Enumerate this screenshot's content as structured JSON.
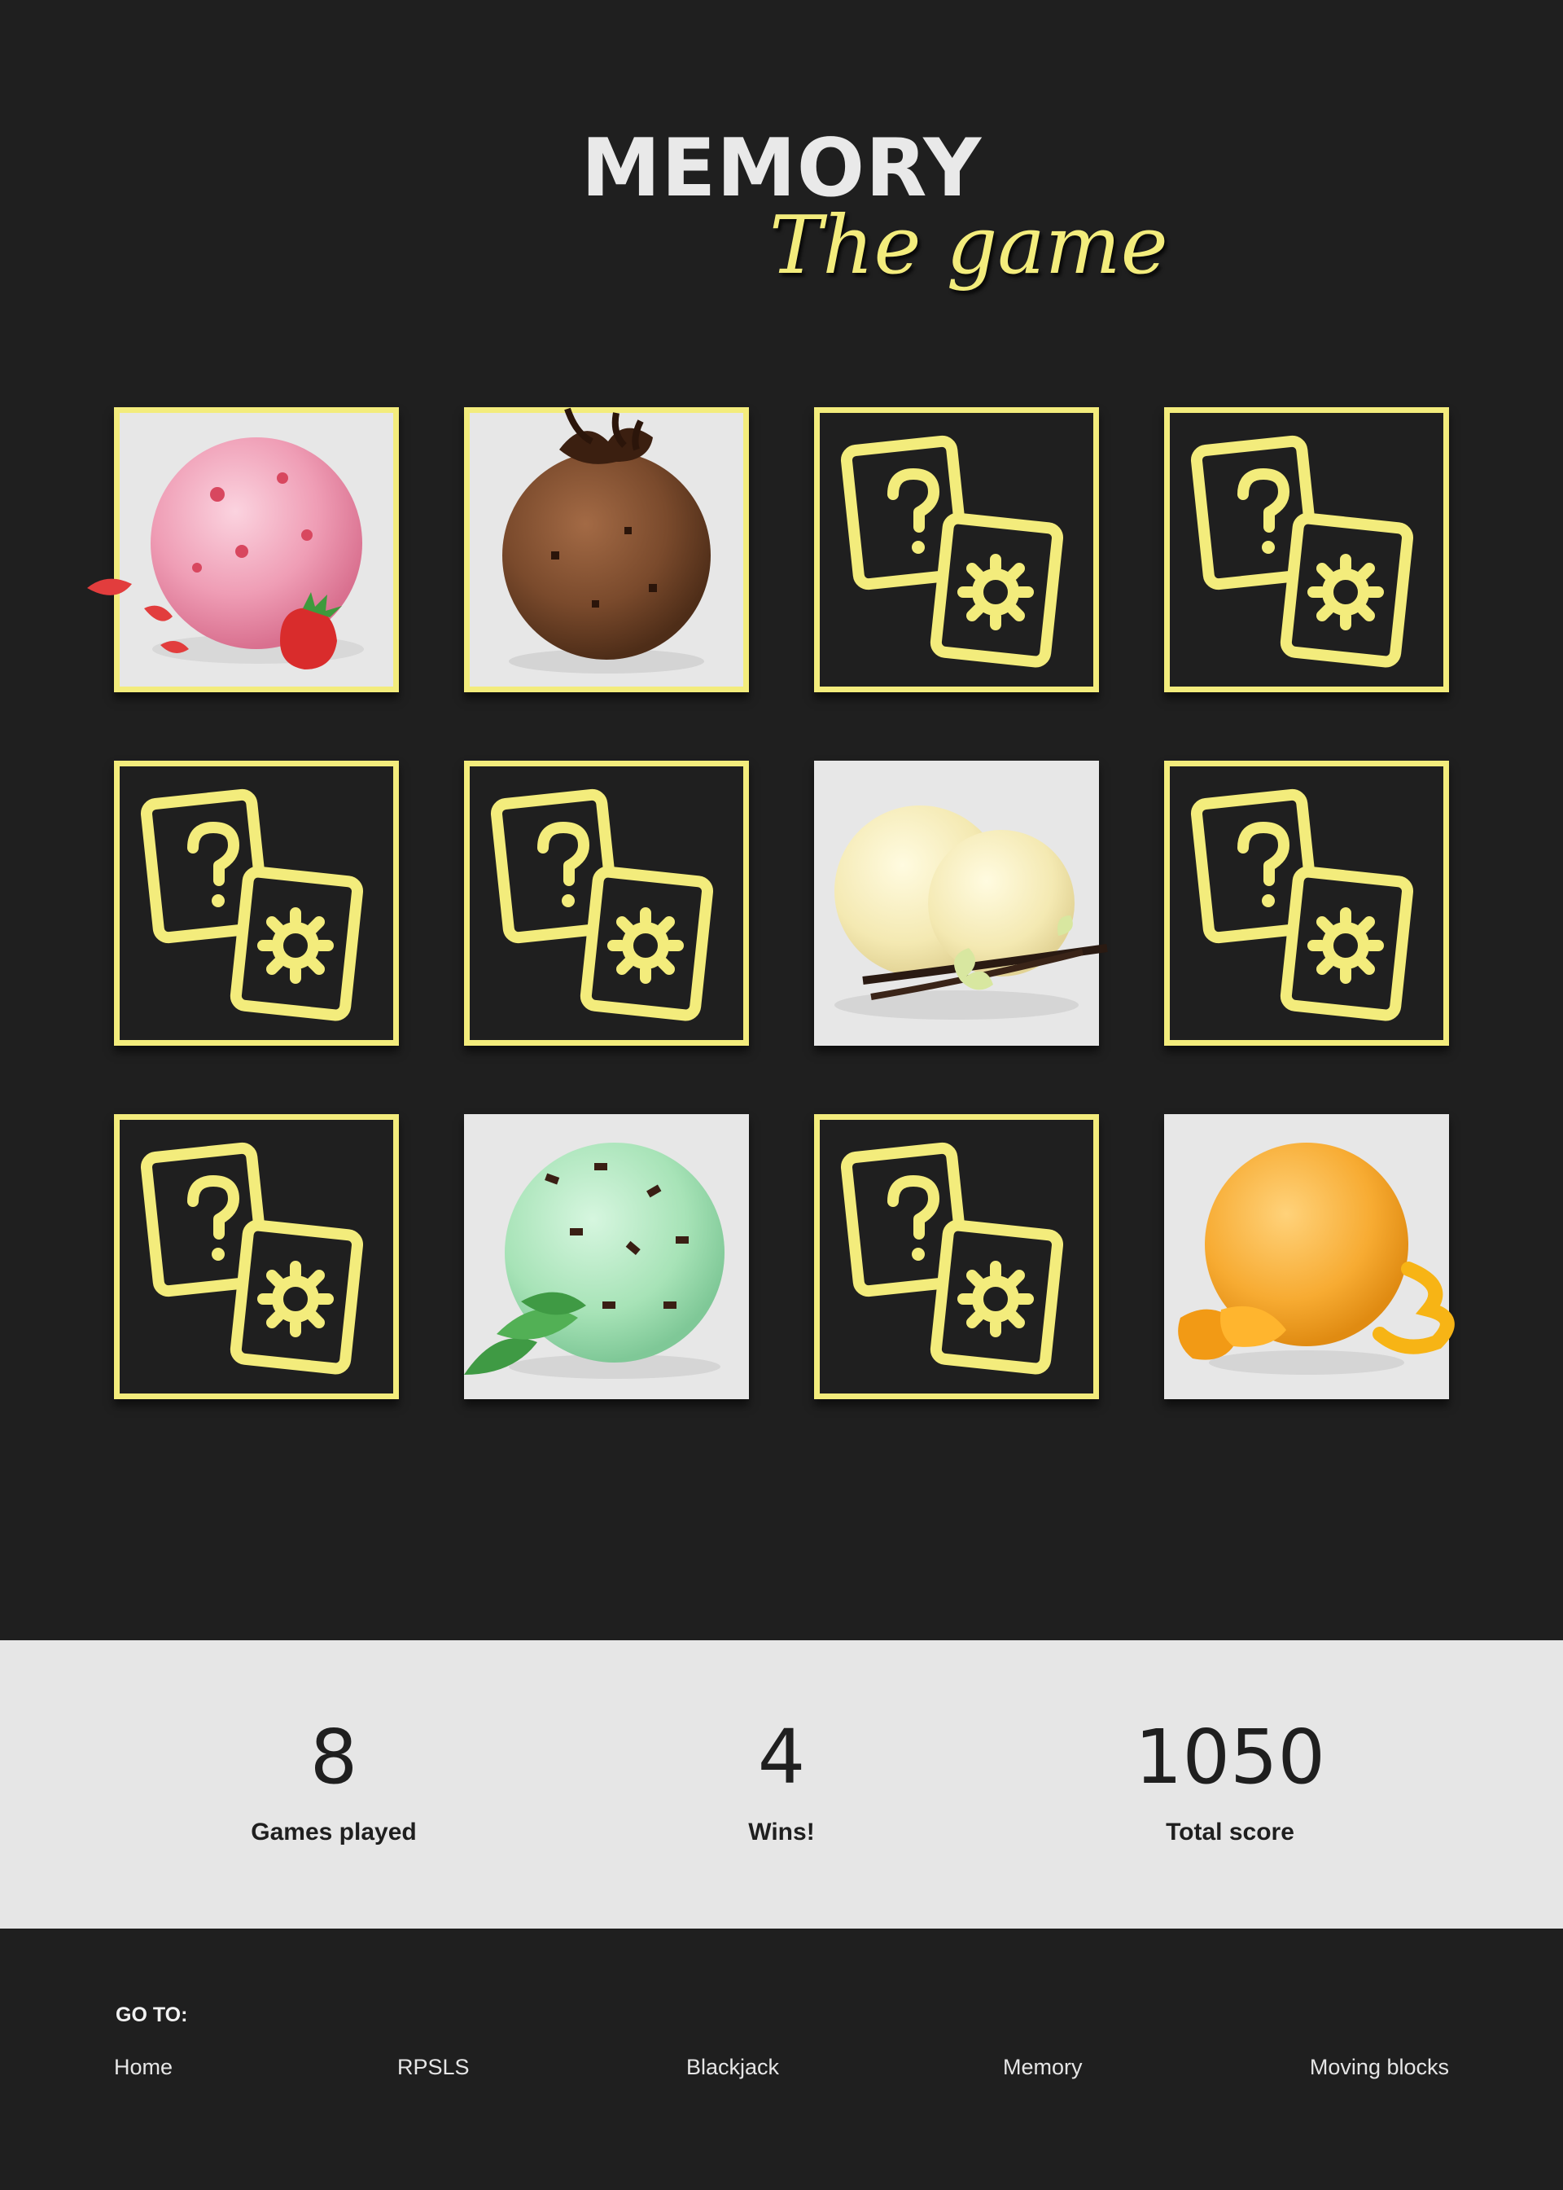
{
  "header": {
    "title": "MEMORY",
    "subtitle": "The game"
  },
  "colors": {
    "background": "#1f1f1f",
    "accent": "#f3ec7c",
    "panel": "#e6e6e6"
  },
  "board": {
    "cards": [
      {
        "state": "flipped",
        "flavor": "strawberry"
      },
      {
        "state": "flipped",
        "flavor": "chocolate"
      },
      {
        "state": "hidden",
        "icon": "question-card-icon"
      },
      {
        "state": "hidden",
        "icon": "question-card-icon"
      },
      {
        "state": "hidden",
        "icon": "question-card-icon"
      },
      {
        "state": "hidden",
        "icon": "question-card-icon"
      },
      {
        "state": "matched",
        "flavor": "vanilla"
      },
      {
        "state": "hidden",
        "icon": "question-card-icon"
      },
      {
        "state": "hidden",
        "icon": "question-card-icon"
      },
      {
        "state": "matched",
        "flavor": "mint-chocolate-chip"
      },
      {
        "state": "hidden",
        "icon": "question-card-icon"
      },
      {
        "state": "matched",
        "flavor": "mango"
      }
    ]
  },
  "stats": {
    "games_played": {
      "value": "8",
      "label": "Games played"
    },
    "wins": {
      "value": "4",
      "label": "Wins!"
    },
    "total_score": {
      "value": "1050",
      "label": "Total score"
    }
  },
  "footer": {
    "goto_label": "GO TO:",
    "links": [
      "Home",
      "RPSLS",
      "Blackjack",
      "Memory",
      "Moving blocks"
    ]
  }
}
